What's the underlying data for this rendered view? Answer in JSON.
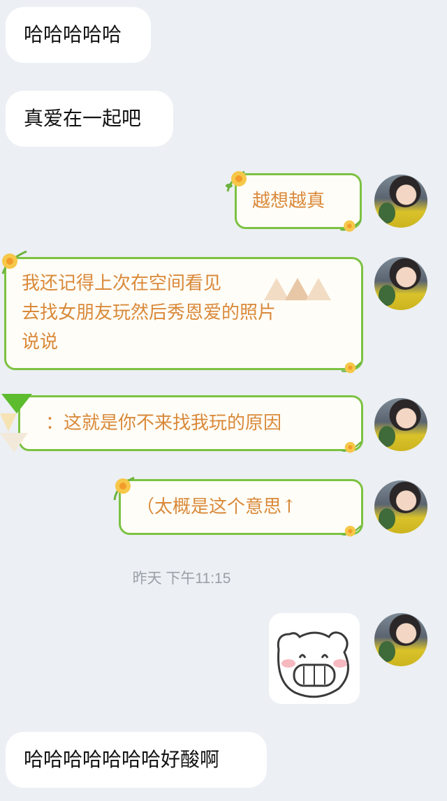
{
  "messages": {
    "m1": {
      "text": "哈哈哈哈哈"
    },
    "m2": {
      "text": "真爱在一起吧"
    },
    "m3": {
      "text": "越想越真"
    },
    "m4": {
      "line1": "我还记得上次在空间看见",
      "line2": "去找女朋友玩然后秀恩爱的照片",
      "line3": "说说"
    },
    "m5": {
      "text": "：这就是你不来找我玩的原因"
    },
    "m6": {
      "text": "（太概是这个意思↑"
    },
    "m7": {
      "text": "哈哈哈哈哈哈哈好酸啊"
    }
  },
  "timestamp": "昨天 下午11:15",
  "sticker": {
    "icon": "grinning-pig-sticker"
  },
  "colors": {
    "background": "#eceff3",
    "bubble_frame": "#7cc242",
    "bubble_text": "#d9893a",
    "flower": "#f6c84a"
  }
}
